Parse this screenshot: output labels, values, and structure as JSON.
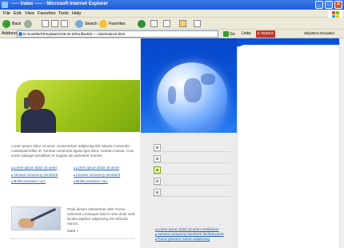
{
  "window": {
    "title": "----- Index ----- - Microsoft Internet Explorer",
    "min_label": "_",
    "max_label": "□",
    "close_label": "×"
  },
  "menubar": {
    "items": [
      "File",
      "Edit",
      "View",
      "Favorites",
      "Tools",
      "Help"
    ]
  },
  "toolbar": {
    "back_label": "Back",
    "search_label": "Search",
    "favorites_label": "Favorites"
  },
  "addressbar": {
    "label": "Address",
    "url": "D:\\!!untitled\\Templates\\!!20.00.00\\Unflash\\t\\-----\\site\\index\\2.html",
    "go_label": "Go",
    "links_label": "Links",
    "chip1": "K ЯNDEX",
    "chip2": "Skip2Eve Emulator"
  },
  "page": {
    "intro": "Lorem ipsum dolor sit amet, consectetuer adipiscing elit. Mauris commodo consequat tellus ut. Aenean commodo ligula eget dolor. Aenean massa. Cum sociis natoque penatibus et magnis dis parturient montes.",
    "links_left": [
      "Lorem ipsum dolor sit amet",
      "Aenean nonummy hendrerit",
      "Mollis portatusr curc"
    ],
    "links_right": [
      "Lorem ipsum dolor sit amet",
      "Aenean nonummy hendrerit",
      "Mollis portatusr curc"
    ],
    "thumb_text": "Proin dictum elementum velit. Fusce euismod consequat ante in sem dolor velit lacinia dapibus adipiscing elit vehicula rutrum.",
    "more_label": "more",
    "more_icon": "»",
    "bottom_links": [
      "Lorem ipsum dolor sit amet vestibulum",
      "Aenean nonummy hendrerit facilisis porta",
      "Fusce posuere rutrum adipiscing"
    ]
  },
  "colors": {
    "titlebar": "#1d5ad8",
    "banner_blue": "#0a5ae0",
    "accent_green": "#9cc419",
    "link_blue": "#1d63b8"
  }
}
